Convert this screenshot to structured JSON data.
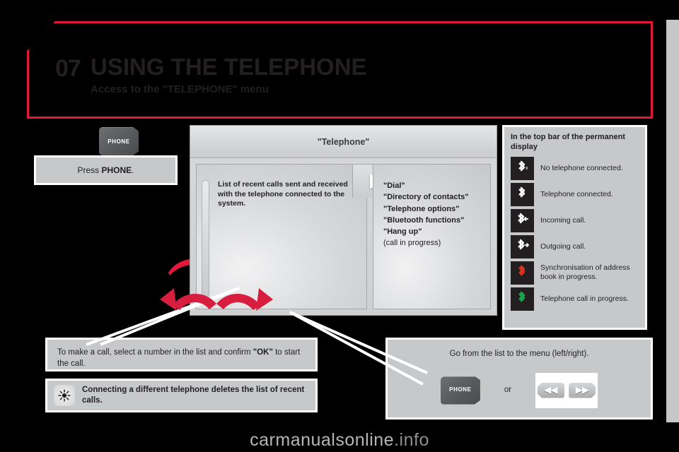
{
  "header": {
    "chapter_number": "07",
    "title": "USING THE TELEPHONE",
    "subtitle": "Access to the \"TELEPHONE\" menu",
    "accent_color": "#e2173a"
  },
  "left": {
    "phone_key_label": "PHONE",
    "press_instruction_prefix": "Press ",
    "press_instruction_bold": "PHONE",
    "press_instruction_suffix": "."
  },
  "screen": {
    "title": "\"Telephone\"",
    "left_pane_text": "List of recent calls sent and received with the telephone connected to the system.",
    "menu_items": [
      {
        "label": "\"Dial\"",
        "bold": true
      },
      {
        "label": "\"Directory of contacts\"",
        "bold": true
      },
      {
        "label": "\"Telephone options\"",
        "bold": true
      },
      {
        "label": "\"Bluetooth functions\"",
        "bold": true
      },
      {
        "label": "\"Hang up\"",
        "bold": true
      },
      {
        "label": "(call in progress)",
        "bold": false
      }
    ]
  },
  "info_panel": {
    "heading": "In the top bar of the permanent display",
    "rows": [
      {
        "icon": "bluetooth-no-phone-icon",
        "color": "#ffffff",
        "badge": "x",
        "label": "No telephone connected."
      },
      {
        "icon": "bluetooth-connected-icon",
        "color": "#ffffff",
        "badge": "",
        "label": "Telephone connected."
      },
      {
        "icon": "bluetooth-incoming-call-icon",
        "color": "#ffffff",
        "badge": "left",
        "label": "Incoming call."
      },
      {
        "icon": "bluetooth-outgoing-call-icon",
        "color": "#ffffff",
        "badge": "right",
        "label": "Outgoing call."
      },
      {
        "icon": "bluetooth-sync-icon",
        "color": "#e2341d",
        "badge": "",
        "label": "Synchronisation of address book in progress."
      },
      {
        "icon": "bluetooth-call-active-icon",
        "color": "#19a94a",
        "badge": "",
        "label": "Telephone call in progress."
      }
    ]
  },
  "bottom": {
    "call_text_part1": "To make a call, select a number in the list and confirm ",
    "call_text_bold": "\"OK\"",
    "call_text_part2": " to start the call.",
    "tip_text": "Connecting a different telephone deletes the list of recent calls.",
    "tip_icon": "star-tip-icon",
    "nav_title": "Go from the list to the menu (left/right).",
    "nav_phone_key_label": "PHONE",
    "nav_or": "or",
    "nav_seek_prev": "◀◀",
    "nav_seek_next": "▶▶"
  },
  "watermark": {
    "text_main": "carmanualsonline",
    "text_dim": ".info"
  }
}
